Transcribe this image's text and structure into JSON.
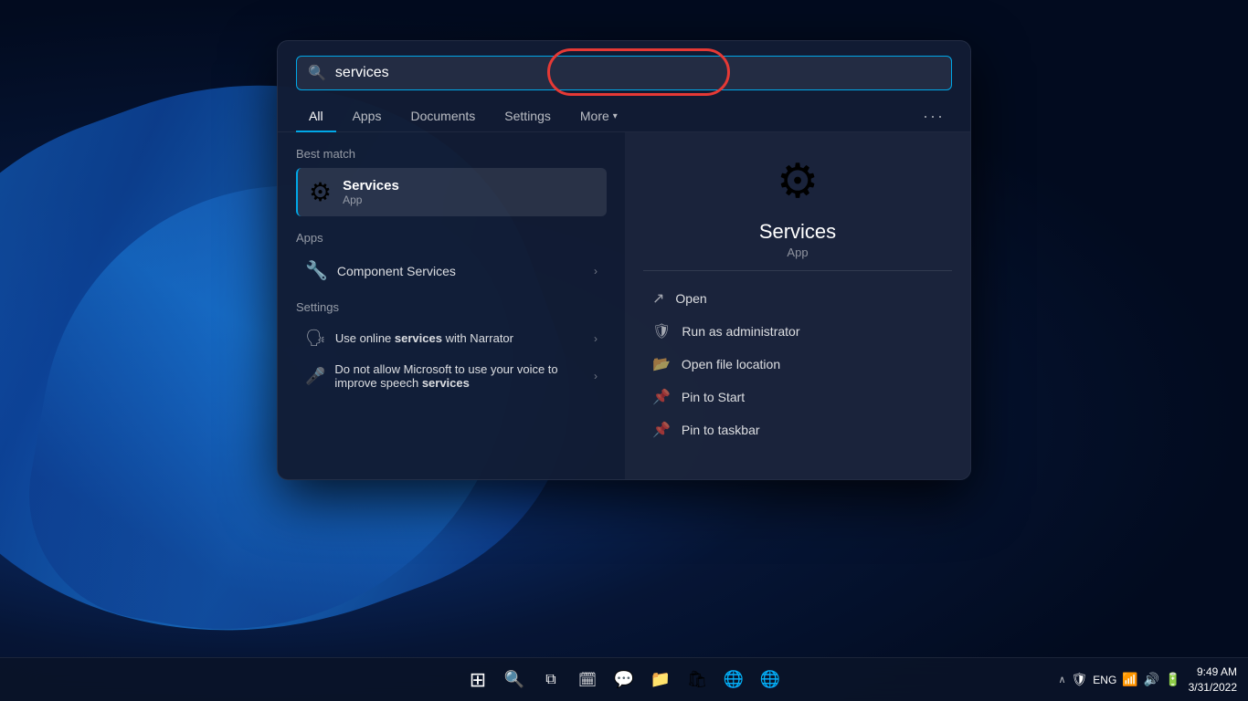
{
  "wallpaper": {
    "alt": "Windows 11 blue wallpaper"
  },
  "search": {
    "placeholder": "services",
    "value": "services",
    "icon": "🔍"
  },
  "filter_tabs": {
    "items": [
      {
        "label": "All",
        "active": true
      },
      {
        "label": "Apps",
        "active": false
      },
      {
        "label": "Documents",
        "active": false
      },
      {
        "label": "Settings",
        "active": false
      },
      {
        "label": "More",
        "active": false,
        "has_chevron": true
      }
    ],
    "more_dots": "···"
  },
  "best_match": {
    "section_label": "Best match",
    "name": "Services",
    "type": "App",
    "icon": "⚙"
  },
  "apps_section": {
    "label": "Apps",
    "items": [
      {
        "name": "Component Services",
        "icon": "🔧",
        "has_chevron": true
      }
    ]
  },
  "settings_section": {
    "label": "Settings",
    "items": [
      {
        "name_plain": "Use online ",
        "name_bold": "services",
        "name_suffix": " with Narrator",
        "icon": "🗣",
        "has_chevron": true
      },
      {
        "name_plain": "Do not allow Microsoft to use your voice to improve speech ",
        "name_bold": "services",
        "name_suffix": "",
        "icon": "🎤",
        "has_chevron": true
      }
    ]
  },
  "right_panel": {
    "app_name": "Services",
    "app_type": "App",
    "icon": "⚙",
    "actions": [
      {
        "label": "Open",
        "icon": "↗"
      },
      {
        "label": "Run as administrator",
        "icon": "🛡"
      },
      {
        "label": "Open file location",
        "icon": "📁"
      },
      {
        "label": "Pin to Start",
        "icon": "📌"
      },
      {
        "label": "Pin to taskbar",
        "icon": "📌"
      }
    ]
  },
  "taskbar": {
    "center_icons": [
      {
        "name": "windows-start",
        "icon": "⊞",
        "label": "Start"
      },
      {
        "name": "search",
        "icon": "🔍",
        "label": "Search"
      },
      {
        "name": "task-view",
        "icon": "⧉",
        "label": "Task View"
      },
      {
        "name": "widgets",
        "icon": "🗓",
        "label": "Widgets"
      },
      {
        "name": "chat",
        "icon": "💬",
        "label": "Chat"
      },
      {
        "name": "file-explorer",
        "icon": "📁",
        "label": "File Explorer"
      },
      {
        "name": "microsoft-store",
        "icon": "🛍",
        "label": "Microsoft Store"
      },
      {
        "name": "edge",
        "icon": "🌐",
        "label": "Microsoft Edge"
      },
      {
        "name": "chrome",
        "icon": "🌐",
        "label": "Google Chrome"
      }
    ],
    "time": "9:49 AM",
    "date": "3/31/2022",
    "lang": "ENG"
  }
}
